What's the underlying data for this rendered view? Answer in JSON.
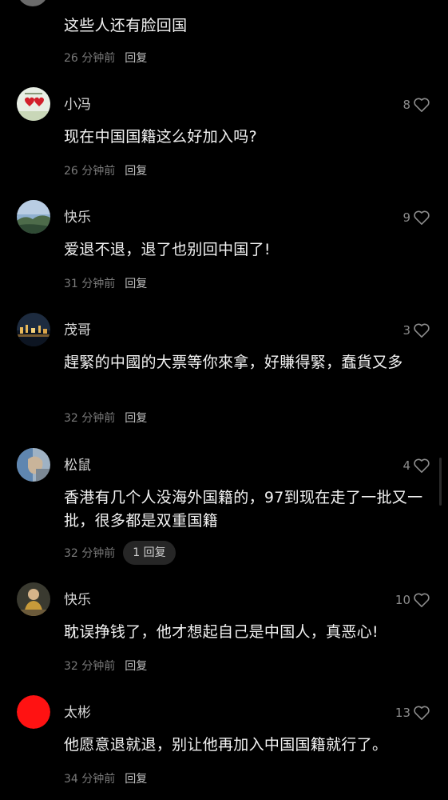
{
  "colors": {
    "background": "#000000",
    "username": "#d9d9d9",
    "text": "#f2f2f2",
    "meta": "#7a7a7a",
    "reply": "#bfbfbf",
    "heart": "#8c8c8c",
    "pill_bg": "#262626"
  },
  "comments": [
    {
      "username": "",
      "text": "这些人还有脸回国",
      "time": "26 分钟前",
      "reply": "回复",
      "likes": ""
    },
    {
      "username": "小冯",
      "text": "现在中国国籍这么好加入吗?",
      "time": "26 分钟前",
      "reply": "回复",
      "likes": "8",
      "avatar": "avatar-hearts"
    },
    {
      "username": "快乐",
      "text": "爱退不退，退了也别回中国了!",
      "time": "31 分钟前",
      "reply": "回复",
      "likes": "9",
      "avatar": "avatar-landscape"
    },
    {
      "username": "茂哥",
      "text": "趕緊的中國的大票等你來拿，好賺得緊，蠢貨又多",
      "time": "32 分钟前",
      "reply": "回复",
      "likes": "3",
      "avatar": "avatar-night-city"
    },
    {
      "username": "松鼠",
      "text": "香港有几个人没海外国籍的，97到现在走了一批又一批，很多都是双重国籍",
      "time": "32 分钟前",
      "reply": "1 回复",
      "likes": "4",
      "avatar": "avatar-squirrel-photo"
    },
    {
      "username": "快乐",
      "text": "耽误挣钱了，他才想起自己是中国人，真恶心!",
      "time": "32 分钟前",
      "reply": "回复",
      "likes": "10",
      "avatar": "avatar-person"
    },
    {
      "username": "太彬",
      "text": "他愿意退就退，别让他再加入中国国籍就行了。",
      "time": "34 分钟前",
      "reply": "回复",
      "likes": "13",
      "avatar": "avatar-red-circle"
    }
  ]
}
